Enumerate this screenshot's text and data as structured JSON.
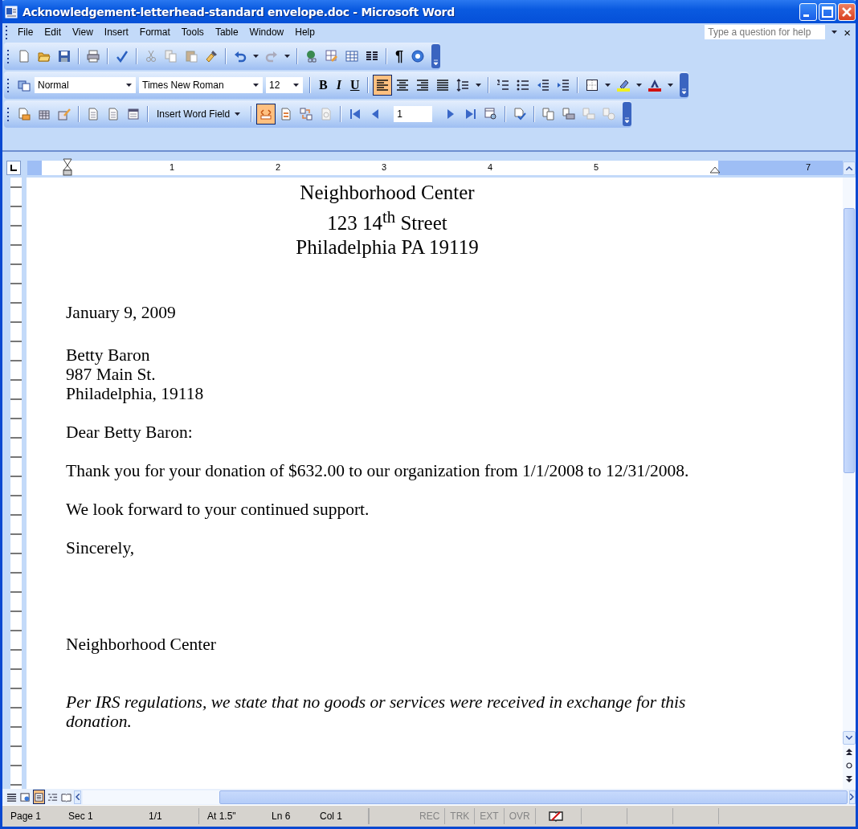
{
  "window": {
    "title": "Acknowledgement-letterhead-standard envelope.doc - Microsoft Word"
  },
  "menu": [
    "File",
    "Edit",
    "View",
    "Insert",
    "Format",
    "Tools",
    "Table",
    "Window",
    "Help"
  ],
  "help_box": {
    "placeholder": "Type a question for help",
    "close": "×"
  },
  "standard_toolbar": {
    "show_hide": "¶"
  },
  "formatting_toolbar": {
    "style": "Normal",
    "font": "Times New Roman",
    "size": "12",
    "bold": "B",
    "italic": "I",
    "underline": "U",
    "alignment": [
      {
        "selected": true
      },
      {
        "selected": false
      },
      {
        "selected": false
      },
      {
        "selected": false
      }
    ]
  },
  "mail_merge_toolbar": {
    "insert_field": "Insert Word Field",
    "view_merged_data": {
      "on": true
    },
    "record": "1"
  },
  "ruler": {
    "labels": [
      "1",
      "2",
      "3",
      "4",
      "5",
      "7"
    ]
  },
  "letterhead": [
    "Neighborhood Center",
    "123 14$^{th}$ Street",
    "Philadelphia PA 19119"
  ],
  "body": [
    {
      "kind": "text",
      "text": "January 9, 2009"
    },
    {
      "kind": "text",
      "text": "Betty Baron"
    },
    {
      "kind": "text",
      "text": "987 Main St."
    },
    {
      "kind": "text",
      "text": "Philadelphia,  19118"
    },
    {
      "kind": "text",
      "text": "Dear Betty Baron:"
    },
    {
      "kind": "text",
      "text": "Thank you for your donation of $632.00 to our organization from 1/1/2008 to 12/31/2008."
    },
    {
      "kind": "text",
      "text": "We look forward to your continued support."
    },
    {
      "kind": "text",
      "text": "Sincerely,"
    },
    {
      "kind": "text",
      "text": "Neighborhood Center"
    },
    {
      "kind": "note",
      "text": "Per IRS regulations, we state that no goods or services were received in exchange for this donation."
    }
  ],
  "view_buttons": [
    {
      "selected": false
    },
    {
      "selected": false
    },
    {
      "selected": true
    },
    {
      "selected": false
    },
    {
      "selected": false
    }
  ],
  "status_bar": {
    "cells": [
      "Page 1",
      "Sec 1",
      "1/1",
      "At 1.5\"",
      "Ln 6",
      "Col 1"
    ],
    "indicators": [
      {
        "label": "REC",
        "active": false
      },
      {
        "label": "TRK",
        "active": false
      },
      {
        "label": "EXT",
        "active": false
      },
      {
        "label": "OVR",
        "active": false
      }
    ]
  }
}
